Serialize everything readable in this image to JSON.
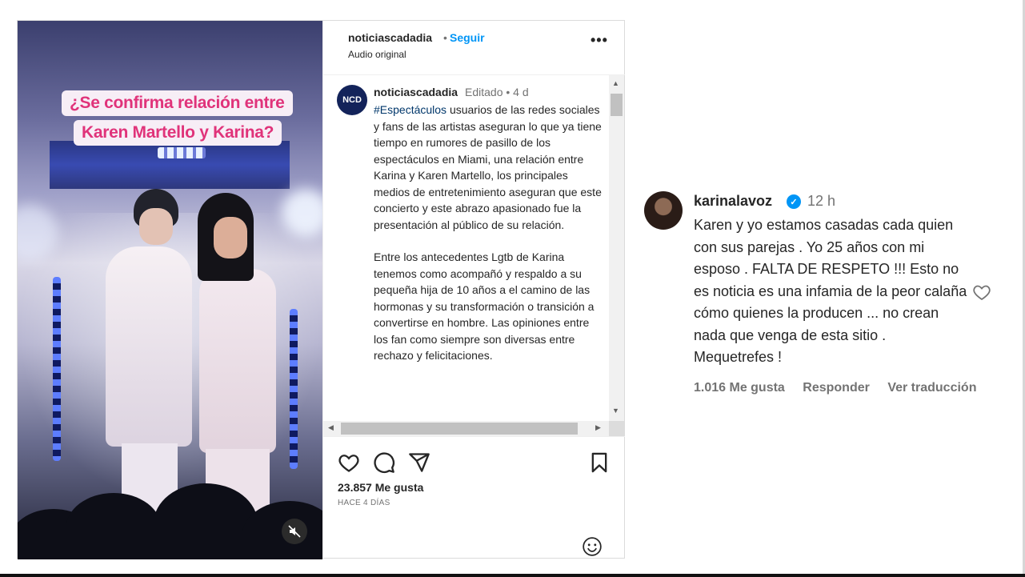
{
  "video": {
    "caption_line1": "¿Se confirma relación entre",
    "caption_line2": "Karen Martello y Karina?"
  },
  "post_header": {
    "username": "noticiascadadia",
    "separator": "•",
    "follow_label": "Seguir",
    "audio_label": "Audio original",
    "more_label": "•••"
  },
  "caption": {
    "avatar_text": "NCD",
    "username": "noticiascadadia",
    "edited_meta": "Editado • 4 d",
    "hashtag": "#Espectáculos",
    "paragraph1": " usuarios de las redes sociales y fans de las artistas aseguran lo que ya tiene tiempo en rumores de pasillo de los espectáculos en Miami, una relación entre Karina y Karen Martello, los principales medios de entretenimiento aseguran que este concierto y este abrazo apasionado fue la presentación al público de su relación.",
    "paragraph2": "Entre los antecedentes Lgtb de Karina tenemos como acompañó y respaldo a su pequeña hija de 10 años a el camino de las hormonas y su transformación o transición a convertirse en hombre. Las opiniones entre los fan como siempre son diversas entre rechazo y felicitaciones."
  },
  "post_footer": {
    "likes": "23.857 Me gusta",
    "time_ago": "HACE 4 DÍAS"
  },
  "comment": {
    "username": "karinalavoz",
    "verified": "✓",
    "time": "12 h",
    "text": "Karen y yo estamos casadas cada quien con sus parejas . Yo 25 años con mi esposo . FALTA DE RESPETO !!! Esto no es noticia es una infamia de la peor calaña cómo quienes la producen ... no crean nada que venga de esta sitio . Mequetrefes !",
    "likes": "1.016 Me gusta",
    "reply_label": "Responder",
    "translate_label": "Ver traducción"
  }
}
